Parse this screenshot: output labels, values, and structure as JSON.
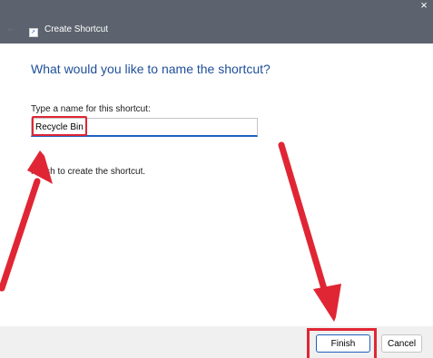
{
  "window": {
    "title": "Create Shortcut",
    "close_glyph": "×",
    "back_glyph": "←"
  },
  "wizard": {
    "heading": "What would you like to name the shortcut?",
    "field_label": "Type a name for this shortcut:",
    "name_value": "Recycle Bin",
    "instruction": "Finish to create the shortcut."
  },
  "buttons": {
    "finish_label": "Finish",
    "cancel_label": "Cancel"
  },
  "colors": {
    "annotation_red": "#e02634",
    "titlebar": "#5c636e",
    "heading_blue": "#1f4f9a",
    "accent_blue": "#1f5fbf"
  }
}
